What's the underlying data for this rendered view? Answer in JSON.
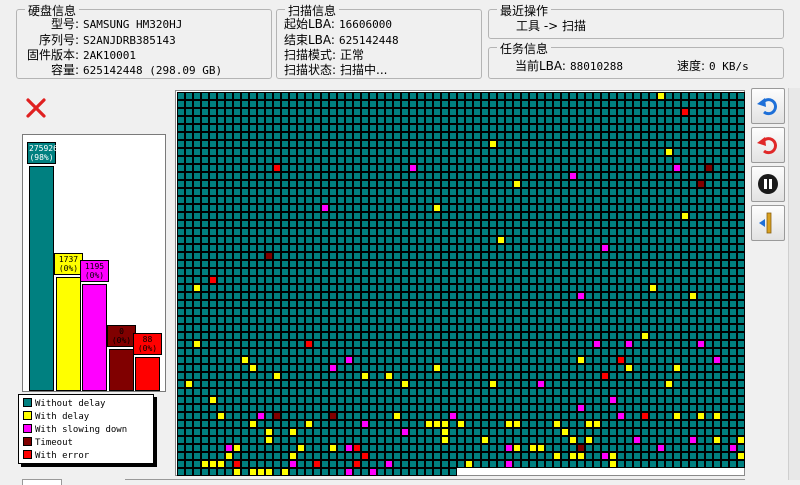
{
  "disk_info": {
    "title": "硬盘信息",
    "model_label": "型号:",
    "model": "SAMSUNG HM320HJ",
    "serial_label": "序列号:",
    "serial": "S2ANJDRB385143",
    "firmware_label": "固件版本:",
    "firmware": "2AK10001",
    "capacity_label": "容量:",
    "capacity": "625142448 (298.09 GB)"
  },
  "scan_info": {
    "title": "扫描信息",
    "start_label": "起始LBA:",
    "start": "16606000",
    "end_label": "结束LBA:",
    "end": "625142448",
    "mode_label": "扫描模式:",
    "mode": "正常",
    "state_label": "扫描状态:",
    "state": "扫描中..."
  },
  "recent": {
    "title": "最近操作",
    "value": "工具 -> 扫描"
  },
  "task": {
    "title": "任务信息",
    "current_lba_label": "当前LBA:",
    "current_lba": "88010288",
    "speed_label": "速度:",
    "speed": "0 KB/s"
  },
  "chart_data": {
    "type": "bar",
    "categories": [
      "Without delay",
      "With delay",
      "With slowing down",
      "Timeout",
      "With error"
    ],
    "values": [
      275926,
      1737,
      1195,
      0,
      88
    ],
    "percent_labels": [
      "(98%)",
      "(0%)",
      "(0%)",
      "(0%)",
      "(0%)"
    ],
    "colors": [
      "#008080",
      "#ffff00",
      "#ff00ff",
      "#800000",
      "#ff0000"
    ]
  },
  "legend": [
    {
      "label": "Without delay",
      "color": "#008080"
    },
    {
      "label": "With delay",
      "color": "#ffff00"
    },
    {
      "label": "With slowing down",
      "color": "#ff00ff"
    },
    {
      "label": "Timeout",
      "color": "#800000"
    },
    {
      "label": "With error",
      "color": "#ff0000"
    }
  ],
  "grid": {
    "columns": 71,
    "rows": 48,
    "filled_cells": 3372
  },
  "toolbar": {
    "undo_icon": "undo-icon",
    "redo_icon": "redo-icon",
    "pause_icon": "pause-icon",
    "split_icon": "split-icon"
  }
}
